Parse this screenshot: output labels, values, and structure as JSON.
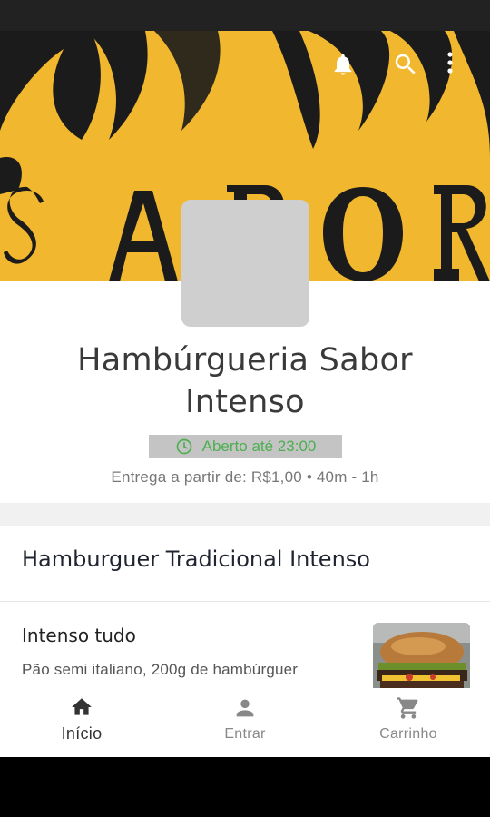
{
  "store": {
    "name": "Hambúrgueria Sabor Intenso",
    "status": "Aberto até 23:00",
    "delivery": "Entrega a partir de: R$1,00 • 40m - 1h"
  },
  "toolbar": {
    "icons": [
      "bell-icon",
      "search-icon",
      "more-vert-icon"
    ]
  },
  "menu": {
    "section_title": "Hamburguer Tradicional Intenso",
    "products": [
      {
        "name": "Intenso tudo",
        "description": "Pão semi italiano, 200g de hambúrguer"
      }
    ]
  },
  "bottom_nav": {
    "items": [
      {
        "label": "Início",
        "icon": "home-icon",
        "active": true
      },
      {
        "label": "Entrar",
        "icon": "person-icon",
        "active": false
      },
      {
        "label": "Carrinho",
        "icon": "cart-icon",
        "active": false
      }
    ]
  },
  "colors": {
    "open_status": "#4caf50",
    "cover_yellow": "#f1b72e"
  }
}
